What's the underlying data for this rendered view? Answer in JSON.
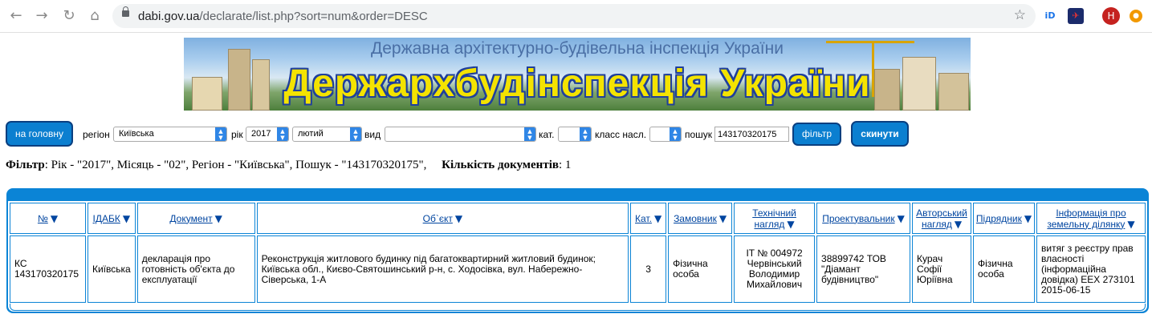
{
  "browser": {
    "url_host": "dabi.gov.ua",
    "url_path": "/declarate/list.php?sort=num&order=DESC",
    "avatar_letter": "H"
  },
  "banner": {
    "subtitle": "Державна архітектурно-будівельна інспекція України",
    "title": "Держархбудінспекція України"
  },
  "toolbar": {
    "home_label": "на головну",
    "region_label": "регіон",
    "region_value": "Київська",
    "year_label": "рік",
    "year_value": "2017",
    "month_value": "лютий",
    "kind_label": "вид",
    "kind_value": "",
    "cat_label": "кат.",
    "cat_value": "",
    "class_label": "класс насл.",
    "class_value": "",
    "search_label": "пошук",
    "search_value": "143170320175",
    "filter_label": "фільтр",
    "reset_label": "скинути"
  },
  "filter_line": {
    "label": "Фільтр",
    "text": ": Рік - \"2017\", Місяць - \"02\", Регіон - \"Київська\", Пошук - \"143170320175\",",
    "count_label": "Кількість документів",
    "count_value": ": 1"
  },
  "table": {
    "headers": [
      {
        "line1": "№",
        "line2": ""
      },
      {
        "line1": "IДАБК",
        "line2": ""
      },
      {
        "line1": "Документ",
        "line2": ""
      },
      {
        "line1": "Об`єкт",
        "line2": ""
      },
      {
        "line1": "Кат.",
        "line2": ""
      },
      {
        "line1": "Замовник",
        "line2": ""
      },
      {
        "line1": "Технічний",
        "line2": "нагляд"
      },
      {
        "line1": "Проектувальник",
        "line2": ""
      },
      {
        "line1": "Авторський",
        "line2": "нагляд"
      },
      {
        "line1": "Підрядник",
        "line2": ""
      },
      {
        "line1": "Інформація про",
        "line2": "земельну ділянку"
      }
    ],
    "row": {
      "num": "КС 143170320175",
      "idabk": "Київська",
      "document": "декларація про готовність об'єкта до експлуатації",
      "object": "Реконструкція житлового будинку під багатоквартирний житловий будинок; Київська обл., Києво-Святошинський р-н, с. Ходосівка, вул. Набережно-Сіверська, 1-А",
      "category": "3",
      "customer": "Фізична особа",
      "tech_supervision": "ІТ № 004972 Червінський Володимир Михайлович",
      "designer": "38899742 ТОВ \"Діамант будівництво\"",
      "author_supervision": "Курач Софії Юріївна",
      "contractor": "Фізична особа",
      "land_info": "витяг з реєстру прав власності (інформаційна довідка) ЕЕХ 273101 2015-06-15"
    }
  }
}
